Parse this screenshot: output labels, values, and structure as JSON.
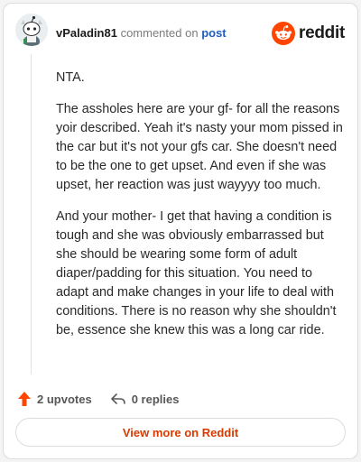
{
  "header": {
    "username": "vPaladin81",
    "action_text": "commented on",
    "post_link": "post",
    "brand_name": "reddit",
    "avatar_icon": "snoo-avatar-icon",
    "brand_icon": "reddit-snoo-icon"
  },
  "comment": {
    "paragraphs": [
      "NTA.",
      "The assholes here are your gf- for all the reasons yoir described. Yeah it's nasty your mom pissed in the car but it's not your gfs car. She doesn't need to be the one to get upset. And even if she was upset, her reaction was just wayyyy too much.",
      "And your mother- I get that having a condition is tough and she was obviously embarrassed but she should be wearing some form of adult diaper/padding for this situation. You need to adapt and make changes in your life to deal with conditions. There is no reason why she shouldn't be, essence she knew this was a long car ride."
    ]
  },
  "footer": {
    "upvotes_label": "2 upvotes",
    "replies_label": "0 replies",
    "upvote_icon": "upvote-arrow-icon",
    "reply_icon": "reply-arrow-icon",
    "view_more_label": "View more on Reddit"
  },
  "colors": {
    "accent": "#d93a00",
    "upvote": "#ff4500",
    "link": "#1f5fbf"
  }
}
